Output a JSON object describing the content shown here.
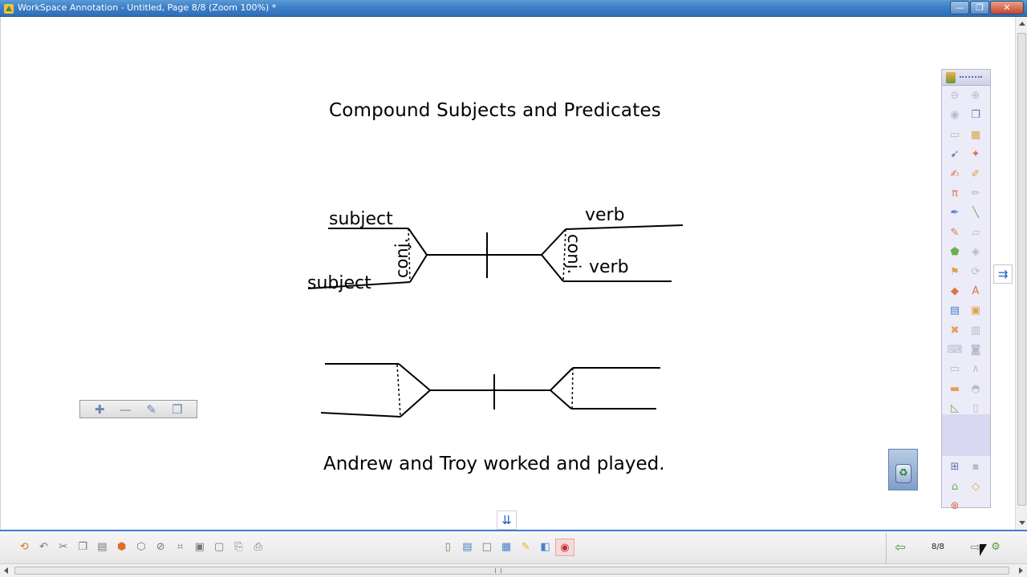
{
  "window": {
    "title": "WorkSpace Annotation - Untitled, Page 8/8  (Zoom 100%) *",
    "minimize_glyph": "—",
    "maximize_glyph": "❐",
    "close_glyph": "✕"
  },
  "slide": {
    "title": "Compound Subjects and Predicates",
    "sentence": "Andrew and Troy worked and played.",
    "diagram_labels": {
      "subject_top": "subject",
      "subject_bottom": "subject",
      "conj_left": "conj.",
      "verb_top": "verb",
      "verb_bottom": "verb",
      "conj_right": "conj."
    }
  },
  "float_toolbar": {
    "buttons": [
      {
        "name": "add-icon",
        "glyph": "✚"
      },
      {
        "name": "minus-icon",
        "glyph": "—"
      },
      {
        "name": "edit-icon",
        "glyph": "✎"
      },
      {
        "name": "clone-icon",
        "glyph": "❐"
      }
    ]
  },
  "side_panel": {
    "buttons": [
      {
        "name": "zoom-out-icon",
        "glyph": "⊖",
        "style": ""
      },
      {
        "name": "zoom-in-icon",
        "glyph": "⊕",
        "style": ""
      },
      {
        "name": "mouse-icon",
        "glyph": "◉",
        "style": ""
      },
      {
        "name": "copy-pages-icon",
        "glyph": "❐",
        "style": "on"
      },
      {
        "name": "screen-icon",
        "glyph": "▭",
        "style": ""
      },
      {
        "name": "image-icon",
        "glyph": "▦",
        "style": "orange"
      },
      {
        "name": "select-icon",
        "glyph": "➹",
        "style": "on"
      },
      {
        "name": "magic-pen-icon",
        "glyph": "✦",
        "style": "red"
      },
      {
        "name": "text-pen-icon",
        "glyph": "✍",
        "style": "red"
      },
      {
        "name": "highlighter-icon",
        "glyph": "✐",
        "style": "orange"
      },
      {
        "name": "pi-pen-icon",
        "glyph": "π",
        "style": "red"
      },
      {
        "name": "pencil-icon",
        "glyph": "✏",
        "style": ""
      },
      {
        "name": "brush-icon",
        "glyph": "✒",
        "style": "blue"
      },
      {
        "name": "line-icon",
        "glyph": "╲",
        "style": "green"
      },
      {
        "name": "marker-icon",
        "glyph": "✎",
        "style": "red"
      },
      {
        "name": "eraser-icon",
        "glyph": "▱",
        "style": ""
      },
      {
        "name": "shape-icon",
        "glyph": "⬟",
        "style": "green"
      },
      {
        "name": "fill-icon",
        "glyph": "◈",
        "style": ""
      },
      {
        "name": "stamp-icon",
        "glyph": "⚑",
        "style": "orange"
      },
      {
        "name": "rotate-icon",
        "glyph": "⟳",
        "style": ""
      },
      {
        "name": "tag-icon",
        "glyph": "◆",
        "style": "red"
      },
      {
        "name": "abc-icon",
        "glyph": "A",
        "style": "red"
      },
      {
        "name": "grid-icon",
        "glyph": "▤",
        "style": "blue"
      },
      {
        "name": "resources-icon",
        "glyph": "▣",
        "style": "orange"
      },
      {
        "name": "clear-icon",
        "glyph": "✖",
        "style": "orange"
      },
      {
        "name": "save-icon",
        "glyph": "▥",
        "style": ""
      },
      {
        "name": "keyboard-icon",
        "glyph": "⌨",
        "style": ""
      },
      {
        "name": "camera-icon",
        "glyph": "◙",
        "style": ""
      },
      {
        "name": "folder-icon",
        "glyph": "▭",
        "style": ""
      },
      {
        "name": "compass-icon",
        "glyph": "∧",
        "style": ""
      },
      {
        "name": "ruler-icon",
        "glyph": "▬",
        "style": "orange"
      },
      {
        "name": "protractor-icon",
        "glyph": "◓",
        "style": ""
      },
      {
        "name": "triangle-icon",
        "glyph": "◺",
        "style": "green"
      },
      {
        "name": "page-icon",
        "glyph": "▯",
        "style": ""
      },
      {
        "name": "document-icon",
        "glyph": "▤",
        "style": ""
      },
      {
        "name": "link-icon",
        "glyph": "⌘",
        "style": ""
      },
      {
        "name": "arrow-left-icon",
        "glyph": "⇦",
        "style": "on"
      },
      {
        "name": "arrow-right-icon",
        "glyph": "⇨",
        "style": ""
      },
      {
        "name": "table-icon",
        "glyph": "⊞",
        "style": "on"
      },
      {
        "name": "disk-icon",
        "glyph": "▪",
        "style": ""
      },
      {
        "name": "tools-icon",
        "glyph": "⌂",
        "style": "green"
      },
      {
        "name": "measure-icon",
        "glyph": "◇",
        "style": "orange"
      },
      {
        "name": "exit-icon",
        "glyph": "⊗",
        "style": "red"
      }
    ]
  },
  "side_collapse": {
    "glyph": "⇉"
  },
  "expand_down": {
    "glyph": "⇊"
  },
  "recycle": {
    "glyph": "♻"
  },
  "bottom_toolbar": {
    "left_buttons": [
      {
        "name": "new-page-icon",
        "glyph": "⟲",
        "style": "c1"
      },
      {
        "name": "undo-icon",
        "glyph": "↶",
        "style": "c2"
      },
      {
        "name": "cut-icon",
        "glyph": "✂",
        "style": "c2"
      },
      {
        "name": "copy-icon",
        "glyph": "❐",
        "style": "c2"
      },
      {
        "name": "paste-icon",
        "glyph": "▤",
        "style": "c2"
      },
      {
        "name": "group-icon",
        "glyph": "⬢",
        "style": "c1"
      },
      {
        "name": "ungroup-icon",
        "glyph": "⬡",
        "style": "c2"
      },
      {
        "name": "lock-icon",
        "glyph": "⊘",
        "style": "c2"
      },
      {
        "name": "crop-icon",
        "glyph": "⌗",
        "style": "c2"
      },
      {
        "name": "front-icon",
        "glyph": "▣",
        "style": "c2"
      },
      {
        "name": "back-icon",
        "glyph": "▢",
        "style": "c2"
      },
      {
        "name": "link-page-icon",
        "glyph": "⎘",
        "style": "c2"
      },
      {
        "name": "print-icon",
        "glyph": "⎙",
        "style": "c2"
      }
    ],
    "middle_buttons": [
      {
        "name": "blank-page-icon",
        "glyph": "▯",
        "style": "c2"
      },
      {
        "name": "lined-page-icon",
        "glyph": "▤",
        "style": "c3"
      },
      {
        "name": "white-page-icon",
        "glyph": "□",
        "style": "c2"
      },
      {
        "name": "gallery-icon",
        "glyph": "▦",
        "style": "c3"
      },
      {
        "name": "note-icon",
        "glyph": "✎",
        "style": "c4"
      },
      {
        "name": "background-icon",
        "glyph": "◧",
        "style": "c3"
      },
      {
        "name": "recorder-icon",
        "glyph": "◉",
        "style": "active"
      }
    ],
    "prev_glyph": "⇦",
    "page_counter": "8/8",
    "next_glyph": "⇨",
    "tools_glyph": "⚙"
  },
  "colors": {
    "titlebar": "#3d7fc8",
    "toolbar_border": "#3f7fd0",
    "side_panel": "#ecebf8",
    "ink": "#000000"
  }
}
